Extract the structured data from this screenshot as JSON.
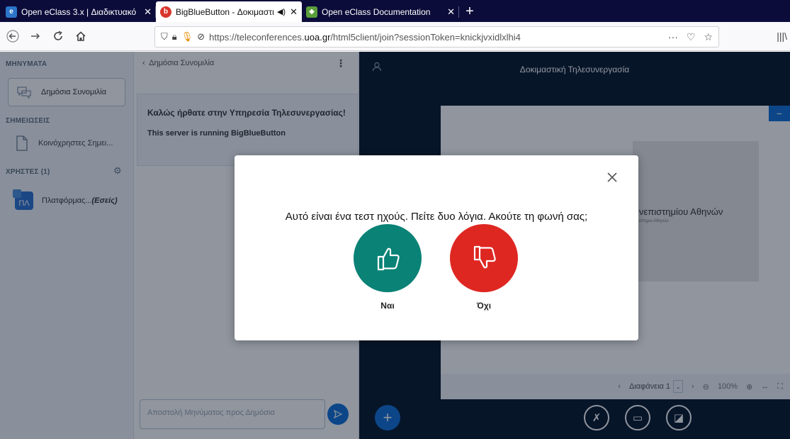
{
  "browser": {
    "tabs": [
      {
        "title": "Open eClass 3.x | Διαδικτυακό",
        "favicon": "eclass"
      },
      {
        "title": "BigBlueButton - Δοκιμαστι",
        "favicon": "bbb"
      },
      {
        "title": "Open eClass Documentation",
        "favicon": "docs"
      }
    ],
    "url": {
      "prefix": "https://teleconferences.",
      "host": "uoa.gr",
      "path": "/html5client/join?sessionToken=knickjvxidlxlhi4"
    },
    "url_more": "···"
  },
  "userlist": {
    "messages_title": "ΜΗΝΥΜΑΤΑ",
    "public_chat": "Δημόσια Συνομιλία",
    "notes_title": "ΣΗΜΕΙΩΣΕΙΣ",
    "shared_notes": "Κοινόχρηστες Σημει...",
    "users_title": "ΧΡΗΣΤΕΣ (1)",
    "user_avatar": "ΠΛ",
    "user_name": "Πλατφόρμας...",
    "user_you": "(Εσείς)"
  },
  "chat": {
    "header": "Δημόσια Συνομιλία",
    "welcome_heading": "Καλώς ήρθατε στην Υπηρεσία Τηλεσυνεργασίας!",
    "welcome_body": "This server is running BigBlueButton",
    "input_placeholder": "Αποστολή Μηνύματος προς Δημόσια"
  },
  "presentation": {
    "title": "Δοκιμαστική Τηλεσυνεργασία",
    "slide_text": "νεπιστημίου Αθηνών",
    "slide_sub": "ιστημιο Αθηνών",
    "slide_select": "Διαφάνεια 1",
    "zoom": "100%"
  },
  "modal": {
    "question": "Αυτό είναι ένα τεστ ηχούς. Πείτε δυο λόγια. Ακούτε τη φωνή σας;",
    "yes_label": "Ναι",
    "no_label": "Όχι"
  },
  "colors": {
    "yes": "#0a8276",
    "no": "#df2722",
    "accent": "#0f70d7"
  }
}
